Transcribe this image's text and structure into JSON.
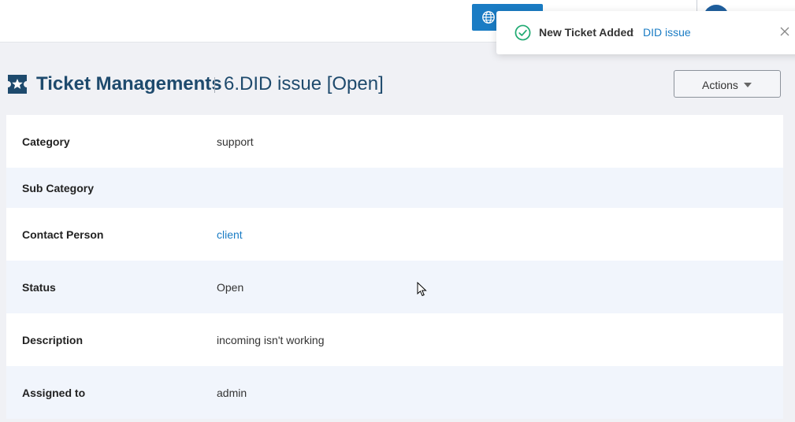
{
  "toast": {
    "title": "New Ticket Added",
    "separator": ":",
    "link": "DID issue",
    "icons": {
      "status": "check-circle-icon",
      "close": "close-icon"
    },
    "colors": {
      "accent": "#1faa72",
      "link": "#1a7cc4"
    }
  },
  "topbar": {
    "language_button_icon": "globe-icon",
    "avatar_icon": "user-avatar"
  },
  "header": {
    "icon": "ticket-star-icon",
    "title": "Ticket Managements",
    "subtitle": "6.DID issue [Open]",
    "actions_label": "Actions"
  },
  "details": [
    {
      "label": "Category",
      "value": "support",
      "is_link": false
    },
    {
      "label": "Sub Category",
      "value": "",
      "is_link": false
    },
    {
      "label": "Contact Person",
      "value": "client",
      "is_link": true
    },
    {
      "label": "Status",
      "value": "Open",
      "is_link": false
    },
    {
      "label": "Description",
      "value": "incoming isn't working",
      "is_link": false
    },
    {
      "label": "Assigned to",
      "value": "admin",
      "is_link": false
    }
  ],
  "colors": {
    "brand": "#1e4a6d",
    "primary": "#1a7cc4",
    "row_tint": "#f1f5fc",
    "page_bg": "#f0f1f5"
  }
}
